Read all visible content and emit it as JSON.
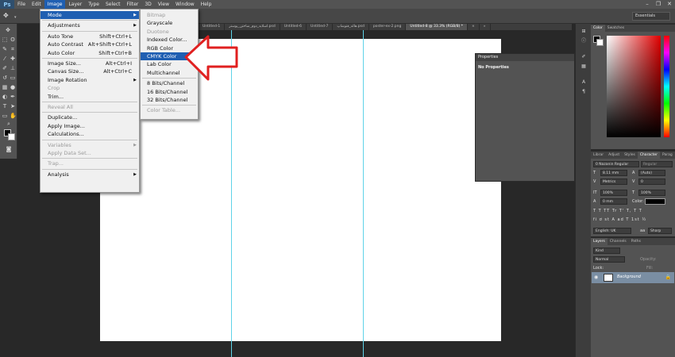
{
  "app": {
    "logo": "Ps"
  },
  "menubar": {
    "items": [
      "File",
      "Edit",
      "Image",
      "Layer",
      "Type",
      "Select",
      "Filter",
      "3D",
      "View",
      "Window",
      "Help"
    ]
  },
  "window_controls": {
    "minimize": "–",
    "restore": "❐",
    "close": "✕"
  },
  "workspace": {
    "label": "Essentials"
  },
  "tabs": [
    {
      "label": "Untitled-1",
      "active": false
    },
    {
      "label": "اسلاید_دوم_ساختن_پوستر.psd",
      "active": false
    },
    {
      "label": "Untitled-6",
      "active": false
    },
    {
      "label": "Untitled-7",
      "active": false
    },
    {
      "label": "هاله_فتوشاپ.psd",
      "active": false
    },
    {
      "label": "poster-ex-2.png",
      "active": false
    },
    {
      "label": "Untitled-8 @ 33.3% (RGB/8) *",
      "active": true
    },
    {
      "label": "×",
      "active": false
    },
    {
      "label": "»",
      "active": false
    }
  ],
  "image_menu": {
    "items": [
      {
        "label": "Mode",
        "shortcut": "",
        "submenu": true,
        "disabled": false,
        "highlighted": true
      },
      {
        "label": "Adjustments",
        "shortcut": "",
        "submenu": true,
        "disabled": false,
        "highlighted": false
      },
      {
        "label": "Auto Tone",
        "shortcut": "Shift+Ctrl+L",
        "submenu": false,
        "disabled": false,
        "highlighted": false
      },
      {
        "label": "Auto Contrast",
        "shortcut": "Alt+Shift+Ctrl+L",
        "submenu": false,
        "disabled": false,
        "highlighted": false
      },
      {
        "label": "Auto Color",
        "shortcut": "Shift+Ctrl+B",
        "submenu": false,
        "disabled": false,
        "highlighted": false
      },
      {
        "label": "Image Size...",
        "shortcut": "Alt+Ctrl+I",
        "submenu": false,
        "disabled": false,
        "highlighted": false
      },
      {
        "label": "Canvas Size...",
        "shortcut": "Alt+Ctrl+C",
        "submenu": false,
        "disabled": false,
        "highlighted": false
      },
      {
        "label": "Image Rotation",
        "shortcut": "",
        "submenu": true,
        "disabled": false,
        "highlighted": false
      },
      {
        "label": "Crop",
        "shortcut": "",
        "submenu": false,
        "disabled": true,
        "highlighted": false
      },
      {
        "label": "Trim...",
        "shortcut": "",
        "submenu": false,
        "disabled": false,
        "highlighted": false
      },
      {
        "label": "Reveal All",
        "shortcut": "",
        "submenu": false,
        "disabled": true,
        "highlighted": false
      },
      {
        "label": "Duplicate...",
        "shortcut": "",
        "submenu": false,
        "disabled": false,
        "highlighted": false
      },
      {
        "label": "Apply Image...",
        "shortcut": "",
        "submenu": false,
        "disabled": false,
        "highlighted": false
      },
      {
        "label": "Calculations...",
        "shortcut": "",
        "submenu": false,
        "disabled": false,
        "highlighted": false
      },
      {
        "label": "Variables",
        "shortcut": "",
        "submenu": true,
        "disabled": true,
        "highlighted": false
      },
      {
        "label": "Apply Data Set...",
        "shortcut": "",
        "submenu": false,
        "disabled": true,
        "highlighted": false
      },
      {
        "label": "Trap...",
        "shortcut": "",
        "submenu": false,
        "disabled": true,
        "highlighted": false
      },
      {
        "label": "Analysis",
        "shortcut": "",
        "submenu": true,
        "disabled": false,
        "highlighted": false
      }
    ]
  },
  "mode_submenu": {
    "items": [
      {
        "label": "Bitmap",
        "disabled": true,
        "highlighted": false
      },
      {
        "label": "Grayscale",
        "disabled": false,
        "highlighted": false
      },
      {
        "label": "Duotone",
        "disabled": true,
        "highlighted": false
      },
      {
        "label": "Indexed Color...",
        "disabled": false,
        "highlighted": false
      },
      {
        "label": "RGB Color",
        "disabled": false,
        "highlighted": false
      },
      {
        "label": "CMYK Color",
        "disabled": false,
        "highlighted": true
      },
      {
        "label": "Lab Color",
        "disabled": false,
        "highlighted": false
      },
      {
        "label": "Multichannel",
        "disabled": false,
        "highlighted": false
      },
      {
        "label": "8 Bits/Channel",
        "disabled": false,
        "highlighted": false
      },
      {
        "label": "16 Bits/Channel",
        "disabled": false,
        "highlighted": false
      },
      {
        "label": "32 Bits/Channel",
        "disabled": false,
        "highlighted": false
      },
      {
        "label": "Color Table...",
        "disabled": true,
        "highlighted": false
      }
    ]
  },
  "properties_panel": {
    "tab": "Properties",
    "content": "No Properties"
  },
  "color_panel": {
    "tabs": [
      "Color",
      "Swatches"
    ]
  },
  "character_panel": {
    "tabs": [
      "Librar",
      "Adjust",
      "Styles",
      "Character",
      "Parag"
    ],
    "font_family": "0 Nazanin Regular",
    "font_style": "Regular",
    "font_size": "8.11 mm",
    "leading": "(Auto)",
    "kerning": "Metrics",
    "tracking": "0",
    "vertical_scale": "100%",
    "horizontal_scale": "100%",
    "baseline_shift": "0 mm",
    "color_label": "Color:",
    "style_buttons": "T T TT Tr T' T, T T",
    "opentype_buttons": "fi ơ st A ad T 1st ½",
    "language": "English: UK",
    "antialias_icon": "aa",
    "antialias": "Sharp"
  },
  "layers_panel": {
    "tabs": [
      "Layers",
      "Channels",
      "Paths"
    ],
    "filter_label": "Kind",
    "blend_mode": "Normal",
    "opacity_label": "Opacity:",
    "lock_label": "Lock:",
    "fill_label": "Fill:",
    "layer_name": "Background"
  },
  "colors": {
    "accent": "#1f5fb2",
    "guide": "#5fd3e8",
    "annotation": "#e02020"
  }
}
